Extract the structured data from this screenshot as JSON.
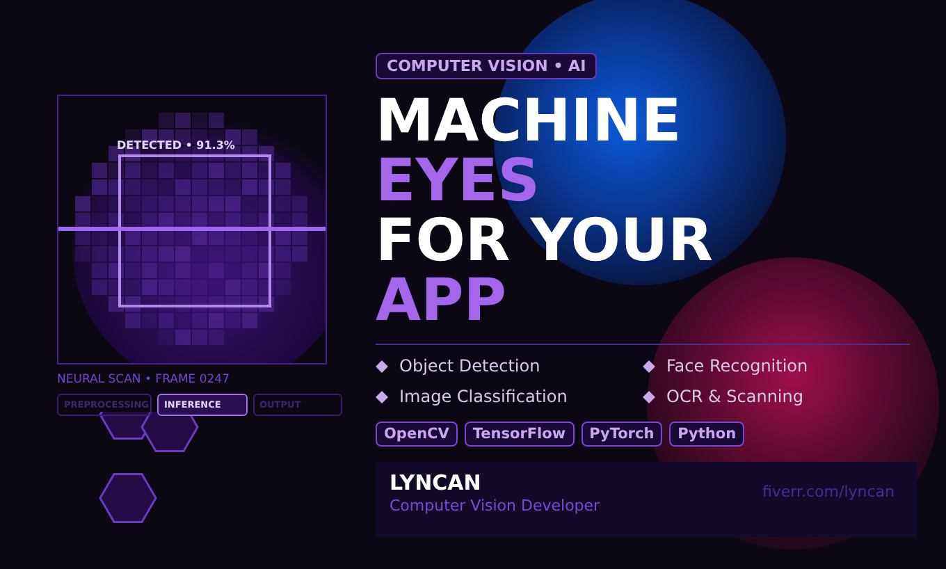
{
  "scan": {
    "detection_label": "DETECTED • 91.3%",
    "caption": "NEURAL SCAN • FRAME 0247",
    "stages": [
      {
        "label": "PREPROCESSING",
        "selected": false
      },
      {
        "label": "INFERENCE",
        "selected": true
      },
      {
        "label": "OUTPUT",
        "selected": false
      }
    ]
  },
  "badge": "COMPUTER VISION • AI",
  "headline": [
    {
      "text": "MACHINE",
      "accent": false
    },
    {
      "text": "EYES",
      "accent": true
    },
    {
      "text": "FOR YOUR",
      "accent": false
    },
    {
      "text": "APP",
      "accent": true
    }
  ],
  "features": [
    "Object Detection",
    "Face Recognition",
    "Image Classification",
    "OCR & Scanning"
  ],
  "tags": [
    "OpenCV",
    "TensorFlow",
    "PyTorch",
    "Python"
  ],
  "profile": {
    "name": "LYNCAN",
    "role": "Computer Vision Developer",
    "link": "fiverr.com/lyncan"
  }
}
